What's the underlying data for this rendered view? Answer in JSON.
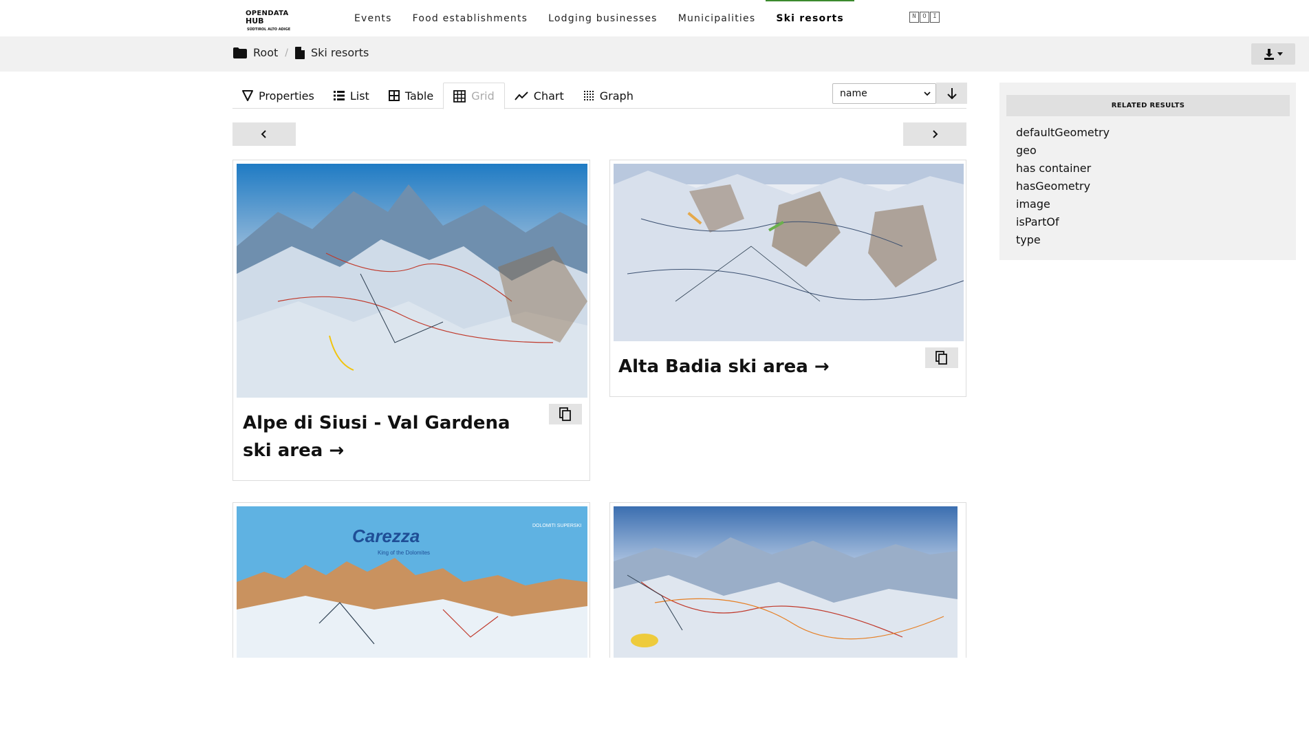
{
  "logo": {
    "line1": "OPENDATA",
    "line2": "HUB",
    "tagline": "SÜDTIROL ALTO ADIGE"
  },
  "nav": {
    "items": [
      {
        "label": "Events"
      },
      {
        "label": "Food establishments"
      },
      {
        "label": "Lodging businesses"
      },
      {
        "label": "Municipalities"
      },
      {
        "label": "Ski resorts",
        "active": true
      }
    ],
    "partner_logo": "NOI",
    "accent_color": "#3c8a2e"
  },
  "breadcrumb": {
    "items": [
      {
        "label": "Root",
        "icon": "folder-icon"
      },
      {
        "label": "Ski resorts",
        "icon": "file-icon"
      }
    ],
    "separator": "/"
  },
  "download": {
    "icon": "download-icon"
  },
  "view_tabs": [
    {
      "label": "Properties",
      "icon": "filter-icon"
    },
    {
      "label": "List",
      "icon": "list-icon"
    },
    {
      "label": "Table",
      "icon": "table-icon"
    },
    {
      "label": "Grid",
      "icon": "grid-icon",
      "active": true
    },
    {
      "label": "Chart",
      "icon": "chart-line-icon"
    },
    {
      "label": "Graph",
      "icon": "graph-icon"
    }
  ],
  "sort": {
    "selected": "name",
    "direction_icon": "arrow-down-icon"
  },
  "pagination": {
    "prev_icon": "chevron-left-icon",
    "next_icon": "chevron-right-icon"
  },
  "cards": [
    {
      "title": "Alpe di Siusi - Val Gardena ski area →",
      "image": "ski map of Alpe di Siusi"
    },
    {
      "title": "Alta Badia ski area →",
      "image": "ski map of Alta Badia"
    },
    {
      "title": "",
      "image": "Carezza ski map",
      "image_text": "Carezza",
      "image_subtext": "King of the Dolomites",
      "image_badge": "DOLOMITI SUPERSKI"
    },
    {
      "title": "",
      "image": "ski resort panorama map"
    }
  ],
  "related": {
    "header": "RELATED RESULTS",
    "items": [
      "defaultGeometry",
      "geo",
      "has container",
      "hasGeometry",
      "image",
      "isPartOf",
      "type"
    ]
  }
}
